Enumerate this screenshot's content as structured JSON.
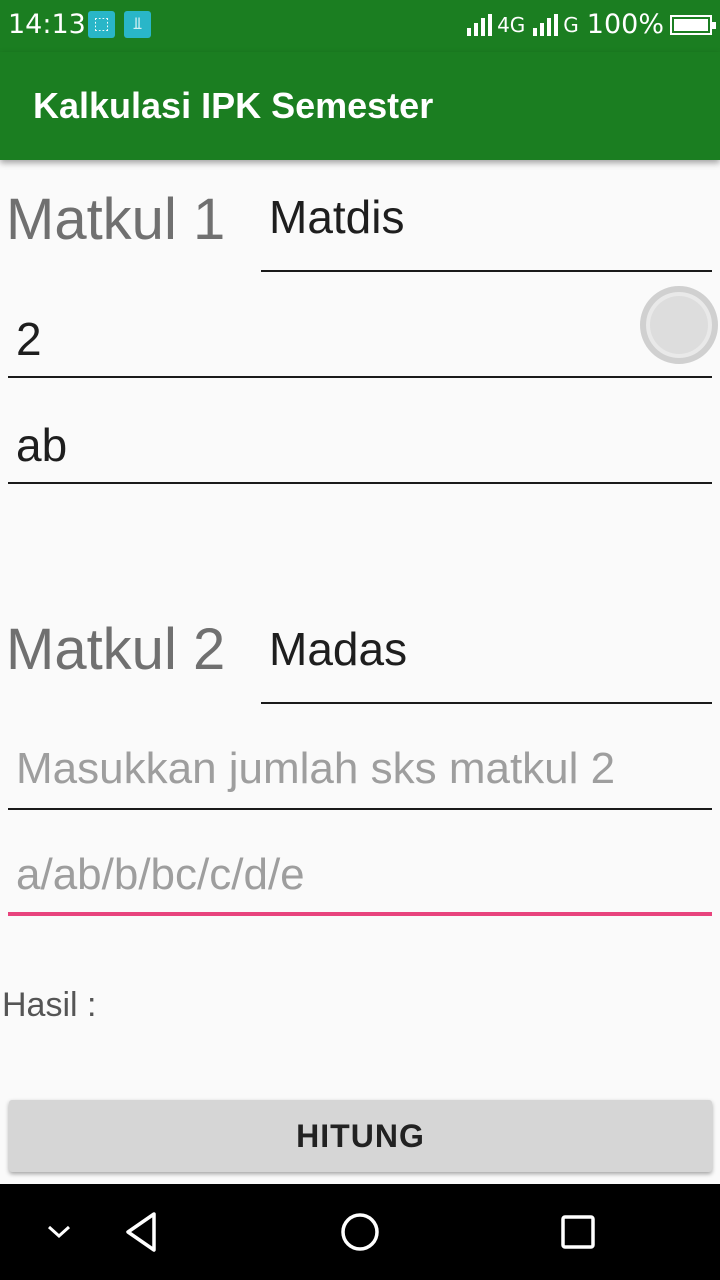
{
  "status_bar": {
    "time": "14:13",
    "network_1": "4G",
    "network_2": "G",
    "battery": "100%",
    "icons": [
      "screenshot-icon",
      "usb-icon"
    ]
  },
  "app_bar": {
    "title": "Kalkulasi IPK Semester"
  },
  "matkul1": {
    "label": "Matkul 1",
    "name_value": "Matdis",
    "sks_value": "2",
    "grade_value": "ab"
  },
  "matkul2": {
    "label": "Matkul 2",
    "name_value": "Madas",
    "sks_placeholder": "Masukkan jumlah sks matkul 2",
    "grade_placeholder": "a/ab/b/bc/c/d/e"
  },
  "result": {
    "label": "Hasil :"
  },
  "actions": {
    "calculate_label": "HITUNG"
  },
  "colors": {
    "primary": "#1b7e21",
    "accent": "#e8437d"
  }
}
